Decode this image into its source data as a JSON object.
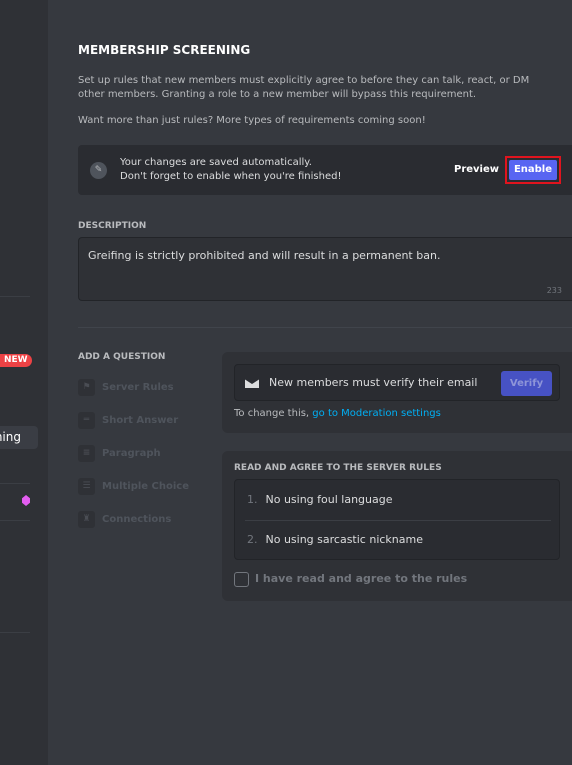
{
  "sidebar": {
    "new_badge": "NEW",
    "selected_item_partial": "ning"
  },
  "page": {
    "title": "MEMBERSHIP SCREENING",
    "intro": "Set up rules that new members must explicitly agree to before they can talk, react, or DM other members. Granting a role to a new member will bypass this requirement.",
    "more": "Want more than just rules? More types of requirements coming soon!"
  },
  "notice": {
    "line1": "Your changes are saved automatically.",
    "line2": "Don't forget to enable when you're finished!",
    "preview": "Preview",
    "enable": "Enable"
  },
  "description": {
    "label": "DESCRIPTION",
    "value": "Greifing is strictly prohibited and will result in a permanent ban.",
    "count": "233"
  },
  "add_question": {
    "label": "ADD A QUESTION",
    "items": [
      {
        "label": "Server Rules",
        "icon": "flag-icon"
      },
      {
        "label": "Short Answer",
        "icon": "short-text-icon"
      },
      {
        "label": "Paragraph",
        "icon": "paragraph-icon"
      },
      {
        "label": "Multiple Choice",
        "icon": "list-icon"
      },
      {
        "label": "Connections",
        "icon": "connections-icon"
      }
    ]
  },
  "email": {
    "text": "New members must verify their email",
    "verify": "Verify",
    "change_prefix": "To change this, ",
    "change_link": "go to Moderation settings"
  },
  "rules": {
    "label": "READ AND AGREE TO THE SERVER RULES",
    "items": [
      {
        "n": "1.",
        "text": "No using foul language"
      },
      {
        "n": "2.",
        "text": "No using sarcastic nickname"
      }
    ],
    "agree": "I have read and agree to the rules"
  },
  "colors": {
    "accent": "#5865f2",
    "link": "#00aff4",
    "new_badge": "#ed4245"
  }
}
